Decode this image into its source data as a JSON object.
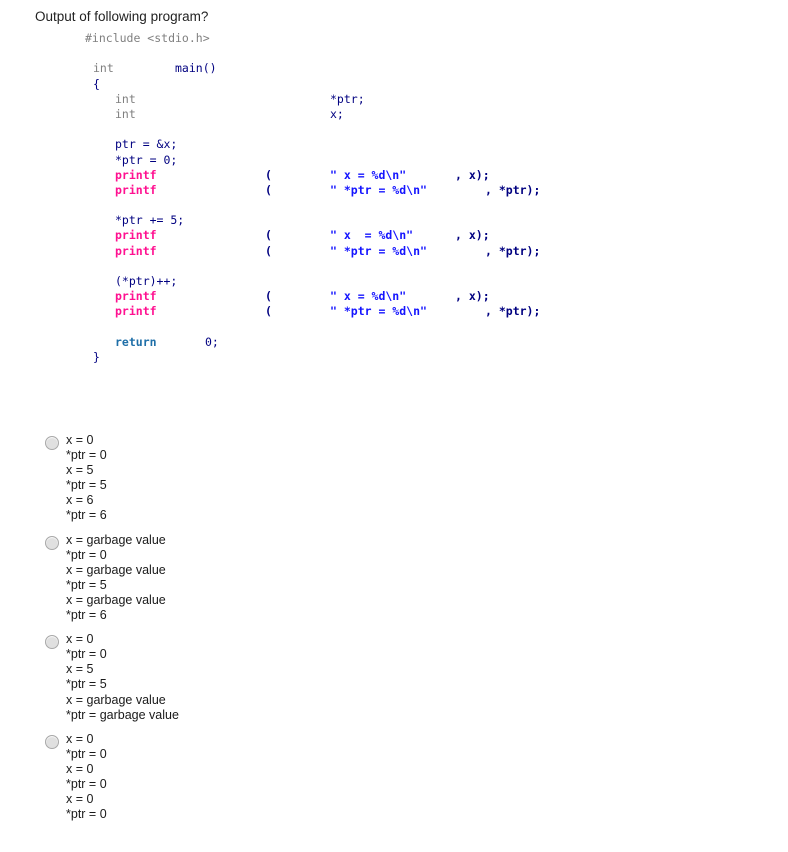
{
  "question": {
    "title": "Output of following program?"
  },
  "code": {
    "language": "c",
    "colors": {
      "keyword_gray": "#808080",
      "function": "#FF1090",
      "string": "#1414FF",
      "return_keyword": "#1F6FA8",
      "plain": "#000080"
    },
    "lines": [
      {
        "indent": "ind1",
        "tokens": [
          {
            "text": "#include <stdio.h>",
            "style": "preproc",
            "col": "c-ind1"
          }
        ]
      },
      {
        "gap": true
      },
      {
        "tokens": [
          {
            "text": "int",
            "style": "keyword-gray",
            "col": "c-ind2"
          },
          {
            "text": "main()",
            "style": "plain",
            "col": "c-kw2"
          }
        ]
      },
      {
        "tokens": [
          {
            "text": "{",
            "style": "plain",
            "col": "c-ind2"
          }
        ]
      },
      {
        "tokens": [
          {
            "text": "int",
            "style": "keyword-gray",
            "col": "c-ind3"
          },
          {
            "text": "*ptr;",
            "style": "plain",
            "col": "c-str"
          }
        ]
      },
      {
        "tokens": [
          {
            "text": "int",
            "style": "keyword-gray",
            "col": "c-ind3"
          },
          {
            "text": "x;",
            "style": "plain",
            "col": "c-str"
          }
        ]
      },
      {
        "gap": true
      },
      {
        "tokens": [
          {
            "text": "ptr = &x;",
            "style": "plain",
            "col": "c-ind3"
          }
        ]
      },
      {
        "tokens": [
          {
            "text": "*ptr = 0;",
            "style": "plain",
            "col": "c-ind3"
          }
        ]
      },
      {
        "tokens": [
          {
            "text": "printf",
            "style": "func",
            "col": "c-ind3"
          },
          {
            "text": "(",
            "style": "punct",
            "col": "c-paren"
          },
          {
            "text": "\" x = %d\\n\"",
            "style": "string",
            "col": "c-str"
          },
          {
            "text": ", x);",
            "style": "punct",
            "col": "c-arg1"
          }
        ]
      },
      {
        "tokens": [
          {
            "text": "printf",
            "style": "func",
            "col": "c-ind3"
          },
          {
            "text": "(",
            "style": "punct",
            "col": "c-paren"
          },
          {
            "text": "\" *ptr = %d\\n\"",
            "style": "string",
            "col": "c-str"
          },
          {
            "text": ", *ptr);",
            "style": "punct",
            "col": "c-arg2"
          }
        ]
      },
      {
        "gap": true
      },
      {
        "tokens": [
          {
            "text": "*ptr += 5;",
            "style": "plain",
            "col": "c-ind3"
          }
        ]
      },
      {
        "tokens": [
          {
            "text": "printf",
            "style": "func",
            "col": "c-ind3"
          },
          {
            "text": "(",
            "style": "punct",
            "col": "c-paren"
          },
          {
            "text": "\" x  = %d\\n\"",
            "style": "string",
            "col": "c-str"
          },
          {
            "text": ", x);",
            "style": "punct",
            "col": "c-arg1"
          }
        ]
      },
      {
        "tokens": [
          {
            "text": "printf",
            "style": "func",
            "col": "c-ind3"
          },
          {
            "text": "(",
            "style": "punct",
            "col": "c-paren"
          },
          {
            "text": "\" *ptr = %d\\n\"",
            "style": "string",
            "col": "c-str"
          },
          {
            "text": ", *ptr);",
            "style": "punct",
            "col": "c-arg2"
          }
        ]
      },
      {
        "gap": true
      },
      {
        "tokens": [
          {
            "text": "(*ptr)++;",
            "style": "plain",
            "col": "c-ind3"
          }
        ]
      },
      {
        "tokens": [
          {
            "text": "printf",
            "style": "func",
            "col": "c-ind3"
          },
          {
            "text": "(",
            "style": "punct",
            "col": "c-paren"
          },
          {
            "text": "\" x = %d\\n\"",
            "style": "string",
            "col": "c-str"
          },
          {
            "text": ", x);",
            "style": "punct",
            "col": "c-arg1"
          }
        ]
      },
      {
        "tokens": [
          {
            "text": "printf",
            "style": "func",
            "col": "c-ind3"
          },
          {
            "text": "(",
            "style": "punct",
            "col": "c-paren"
          },
          {
            "text": "\" *ptr = %d\\n\"",
            "style": "string",
            "col": "c-str"
          },
          {
            "text": ", *ptr);",
            "style": "punct",
            "col": "c-arg2"
          }
        ]
      },
      {
        "gap": true
      },
      {
        "tokens": [
          {
            "text": "return",
            "style": "return",
            "col": "c-ind3"
          },
          {
            "text": "0;",
            "style": "plain",
            "col": "c-ret"
          }
        ]
      },
      {
        "tokens": [
          {
            "text": "}",
            "style": "plain",
            "col": "c-ind2"
          }
        ]
      }
    ]
  },
  "options": [
    {
      "selected": false,
      "label": "x = 0\n*ptr = 0\nx = 5\n*ptr = 5\nx = 6\n*ptr = 6"
    },
    {
      "selected": false,
      "label": "x = garbage value\n*ptr = 0\nx = garbage value\n*ptr = 5\nx = garbage value\n*ptr = 6"
    },
    {
      "selected": false,
      "label": "x = 0\n*ptr = 0\nx = 5\n*ptr = 5\nx = garbage value\n*ptr = garbage value"
    },
    {
      "selected": false,
      "label": "x = 0\n*ptr = 0\nx = 0\n*ptr = 0\nx = 0\n*ptr = 0"
    }
  ]
}
